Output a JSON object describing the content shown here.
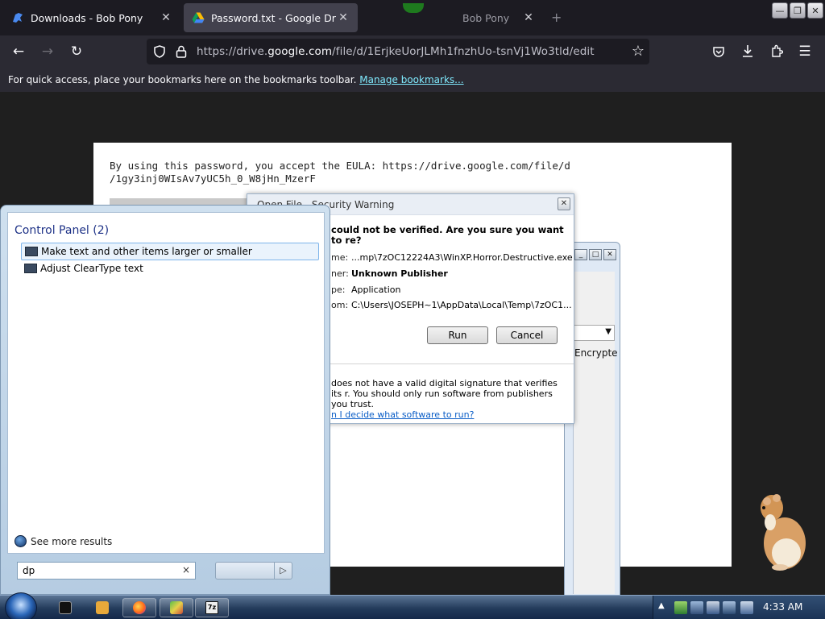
{
  "browser": {
    "tabs": [
      {
        "label": "Downloads - Bob Pony",
        "active": false
      },
      {
        "label": "Password.txt - Google Drive",
        "active": true
      },
      {
        "label": "Bob Pony",
        "active": false
      }
    ],
    "url_prefix": "https://drive.",
    "url_domain": "google.com",
    "url_path": "/file/d/1ErjkeUorJLMh1fnzhUo-tsnVj1Wo3tld/edit",
    "bookmarks_text": "For quick access, place your bookmarks here on the bookmarks toolbar.",
    "bookmarks_link": "Manage bookmarks..."
  },
  "document": {
    "line1": "By using this password, you accept the EULA: https://drive.google.com/file/d",
    "line2": "/1gy3inj0WIsAv7yUC5h_0_W8jHn_MzerF"
  },
  "security_dialog": {
    "title": "Open File - Security Warning",
    "question": "could not be verified.  Are you sure you want to re?",
    "fields": [
      {
        "key": "me:",
        "value": "...mp\\7zOC12224A3\\WinXP.Horror.Destructive.exe"
      },
      {
        "key": "ner:",
        "value": "Unknown Publisher"
      },
      {
        "key": "pe:",
        "value": "Application"
      },
      {
        "key": "om:",
        "value": "C:\\Users\\JOSEPH~1\\AppData\\Local\\Temp\\7zOC1..."
      }
    ],
    "run_label": "Run",
    "cancel_label": "Cancel",
    "footer_text": "does not have a valid digital signature that verifies its r. You should only run software from publishers you trust.",
    "footer_link": "n I decide what software to run?"
  },
  "background_window": {
    "field_text": "Encrypte"
  },
  "start_menu": {
    "group_header": "Control Panel (2)",
    "results": [
      {
        "label": "Make text and other items larger or smaller",
        "selected": true
      },
      {
        "label": "Adjust ClearType text",
        "selected": false
      }
    ],
    "see_more": "See more results",
    "search_value": "dp",
    "clear_symbol": "×"
  },
  "taskbar": {
    "clock": "4:33 AM",
    "buttons": [
      "cmd-icon",
      "media-icon",
      "firefox-icon",
      "paint-icon",
      "7zip-icon"
    ]
  },
  "colors": {
    "firefox_dark": "#1c1b22",
    "toolbar": "#2b2a33",
    "link": "#80ebff",
    "taskbar": "#233b5b"
  }
}
